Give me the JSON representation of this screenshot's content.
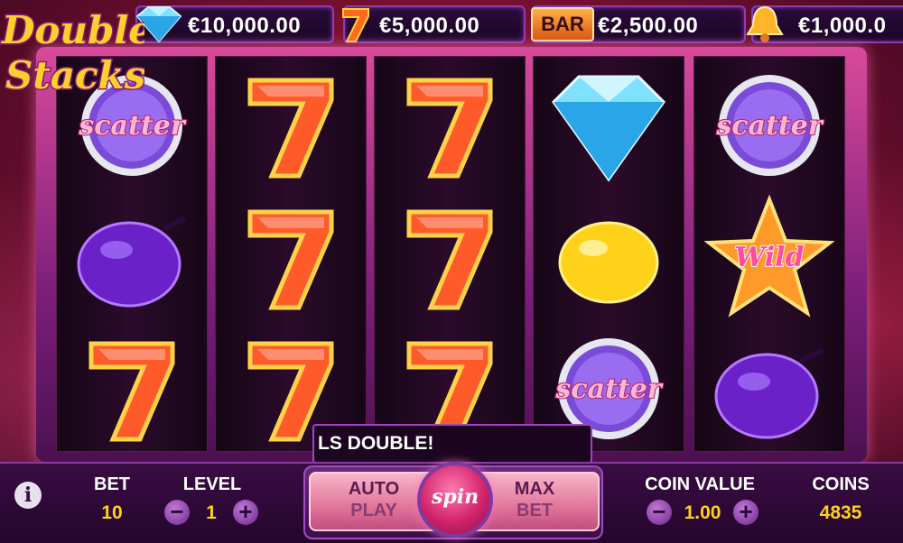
{
  "jackpots": [
    {
      "icon": "diamond-icon",
      "value": "€10,000.00"
    },
    {
      "icon": "seven-icon",
      "value": "€5,000.00"
    },
    {
      "icon": "bar-icon",
      "label": "BAR",
      "value": "€2,500.00"
    },
    {
      "icon": "bell-icon",
      "value": "€1,000.0"
    }
  ],
  "logo": {
    "line1": "Double",
    "line2": "Stacks"
  },
  "reels": [
    [
      "scatter",
      "plum",
      "seven"
    ],
    [
      "seven",
      "seven",
      "seven"
    ],
    [
      "seven",
      "seven",
      "seven"
    ],
    [
      "diamond",
      "lemon",
      "scatter"
    ],
    [
      "scatter",
      "wild",
      "plum"
    ]
  ],
  "symbol_text": {
    "scatter": "scatter",
    "wild": "Wild"
  },
  "message": "LS DOUBLE!",
  "controls": {
    "info": "i",
    "bet_label": "BET",
    "bet_value": "10",
    "level_label": "LEVEL",
    "level_value": "1",
    "autoplay_line1": "AUTO",
    "autoplay_line2": "PLAY",
    "spin_label": "spin",
    "maxbet_line1": "MAX",
    "maxbet_line2": "BET",
    "coin_value_label": "COIN VALUE",
    "coin_value": "1.00",
    "coins_label": "COINS",
    "coins_value": "4835",
    "minus": "−",
    "plus": "+"
  },
  "colors": {
    "accent_yellow": "#ffd21a",
    "frame_pink": "#d94a9a",
    "panel_purple": "#3a0c44"
  }
}
